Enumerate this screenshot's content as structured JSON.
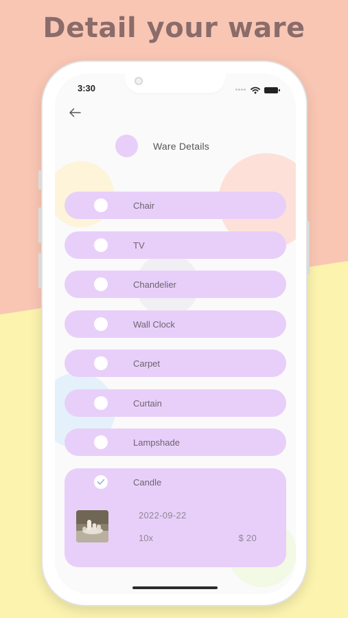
{
  "promo": {
    "headline": "Detail your ware"
  },
  "colors": {
    "background_pink": "#f9c6b4",
    "background_yellow": "#fbf3ae",
    "accent_lilac": "#e8cff9",
    "headline": "#8a6c6a"
  },
  "status_bar": {
    "time": "3:30",
    "icons": [
      "signal-icon",
      "wifi-icon",
      "battery-icon"
    ]
  },
  "nav": {
    "back_icon": "arrow-left-icon"
  },
  "header": {
    "title": "Ware Details"
  },
  "wares": [
    {
      "label": "Chair",
      "checked": false
    },
    {
      "label": "TV",
      "checked": false
    },
    {
      "label": "Chandelier",
      "checked": false
    },
    {
      "label": "Wall Clock",
      "checked": false
    },
    {
      "label": "Carpet",
      "checked": false
    },
    {
      "label": "Curtain",
      "checked": false
    },
    {
      "label": "Lampshade",
      "checked": false
    },
    {
      "label": "Candle",
      "checked": true,
      "date": "2022-09-22",
      "quantity": "10x",
      "price": "$ 20"
    }
  ]
}
